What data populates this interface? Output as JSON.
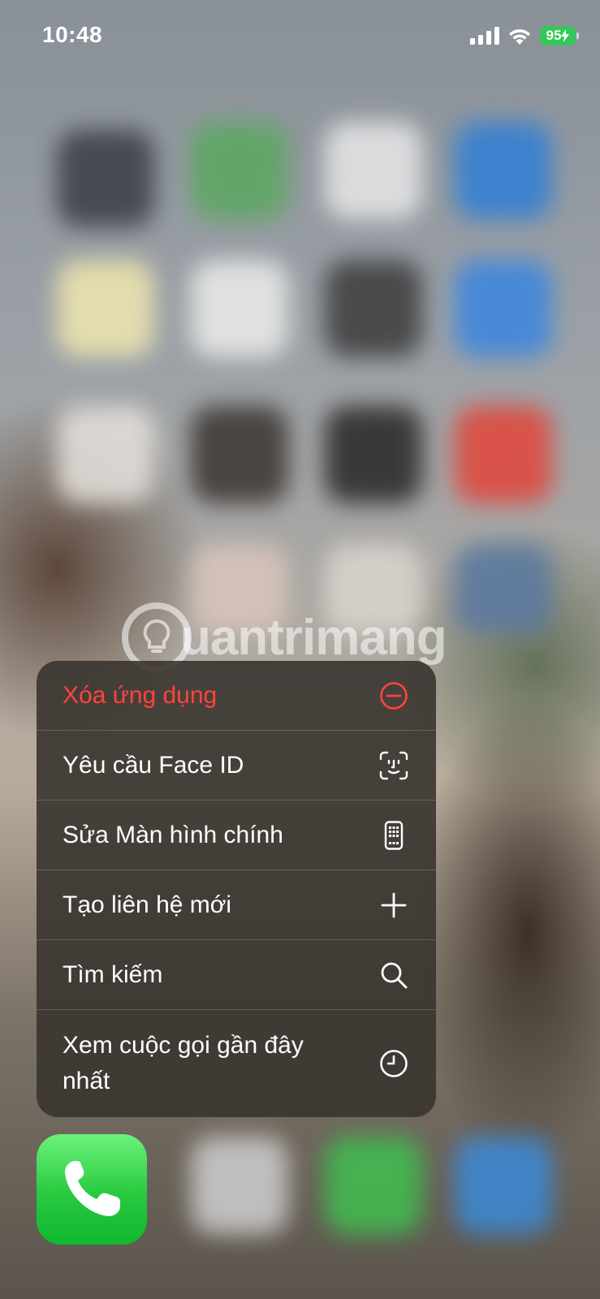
{
  "status_bar": {
    "time": "10:48",
    "battery": "95"
  },
  "watermark": "uantrimang",
  "context_menu": {
    "items": [
      {
        "label": "Xóa ứng dụng",
        "icon": "minus-circle-icon",
        "destructive": true
      },
      {
        "label": "Yêu cầu Face ID",
        "icon": "face-id-icon",
        "destructive": false
      },
      {
        "label": "Sửa Màn hình chính",
        "icon": "phone-grid-icon",
        "destructive": false
      },
      {
        "label": "Tạo liên hệ mới",
        "icon": "plus-icon",
        "destructive": false
      },
      {
        "label": "Tìm kiếm",
        "icon": "search-icon",
        "destructive": false
      },
      {
        "label": "Xem cuộc gọi gần đây nhất",
        "icon": "clock-icon",
        "destructive": false
      }
    ]
  },
  "colors": {
    "destructive": "#ff453a",
    "phone_app_green": "#27c93f",
    "battery_green": "#34c759"
  }
}
